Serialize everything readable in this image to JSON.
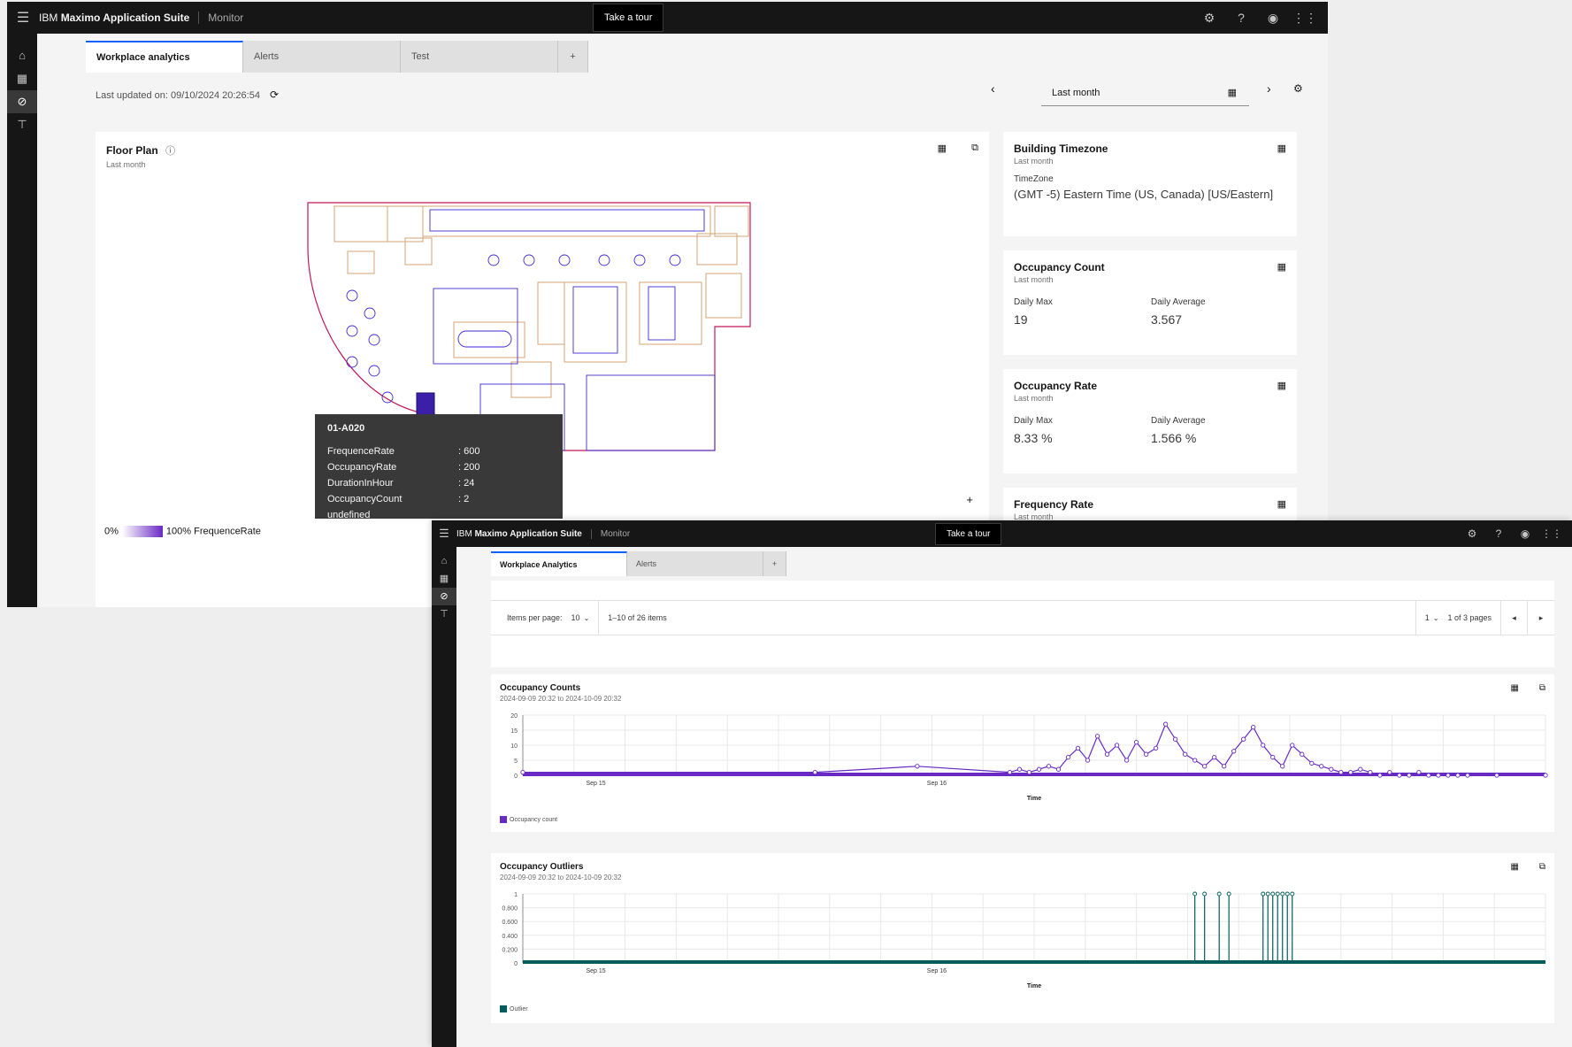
{
  "app": {
    "brand_prefix": "IBM",
    "brand_name": "Maximo Application Suite",
    "product": "Monitor",
    "tour": "Take a tour"
  },
  "icons": {
    "hamburger": "☰",
    "settings": "⚙",
    "help": "?",
    "user": "◉",
    "apps": "⋮⋮",
    "home": "⌂",
    "grid": "▦",
    "compass": "⊘",
    "network": "⊤",
    "calendar": "▦",
    "expand": "⧉",
    "info": "ⓘ",
    "refresh": "⟳",
    "prev": "‹",
    "next": "›",
    "plus": "+"
  },
  "win1": {
    "tabs": [
      "Workplace analytics",
      "Alerts",
      "Test",
      "+"
    ],
    "last_updated": "Last updated on:  09/10/2024 20:26:54",
    "date_range": "Last month",
    "floorplan": {
      "title": "Floor Plan",
      "subtitle": "Last month",
      "legend_min": "0%",
      "legend_max": "100% FrequenceRate",
      "zoom": "+"
    },
    "tooltip": {
      "title": "01-A020",
      "rows": [
        {
          "k": "FrequenceRate",
          "v": ": 600"
        },
        {
          "k": "OccupancyRate",
          "v": ": 200"
        },
        {
          "k": "DurationInHour",
          "v": ": 24"
        },
        {
          "k": "OccupancyCount",
          "v": ": 2"
        }
      ],
      "footer": "undefined"
    },
    "timezone": {
      "title": "Building Timezone",
      "subtitle": "Last month",
      "label": "TimeZone",
      "value": "(GMT -5) Eastern Time (US, Canada) [US/Eastern]"
    },
    "occ_count": {
      "title": "Occupancy Count",
      "subtitle": "Last month",
      "max_label": "Daily Max",
      "max_value": "19",
      "avg_label": "Daily Average",
      "avg_value": "3.567"
    },
    "occ_rate": {
      "title": "Occupancy Rate",
      "subtitle": "Last month",
      "max_label": "Daily Max",
      "max_value": "8.33 %",
      "avg_label": "Daily Average",
      "avg_value": "1.566 %"
    },
    "freq_rate": {
      "title": "Frequency Rate",
      "subtitle": "Last month"
    }
  },
  "win2": {
    "tabs": [
      "Workplace Analytics",
      "Alerts",
      "+"
    ],
    "pager": {
      "items_label": "Items per page:",
      "items_value": "10",
      "range": "1–10 of 26 items",
      "page_value": "1",
      "pages": "1 of 3 pages"
    },
    "chart1": {
      "title": "Occupancy Counts",
      "subtitle": "2024-09-09 20:32 to 2024-10-09 20:32",
      "ticks": [
        "20",
        "15",
        "10",
        "5",
        "0"
      ],
      "xticks": [
        "Sep 15",
        "Sep 16"
      ],
      "xlabel": "Time",
      "legend": "Occupancy count"
    },
    "chart2": {
      "title": "Occupancy Outliers",
      "subtitle": "2024-09-09 20:32 to 2024-10-09 20:32",
      "ticks": [
        "1",
        "0.800",
        "0.600",
        "0.400",
        "0.200",
        "0"
      ],
      "xticks": [
        "Sep 15",
        "Sep 16"
      ],
      "xlabel": "Time",
      "legend": "Outlier"
    }
  },
  "colors": {
    "accent": "#0f62fe",
    "series_purple": "#6929c4",
    "series_teal": "#005d5d"
  },
  "chart_data": [
    {
      "type": "line",
      "title": "Occupancy Counts",
      "subtitle": "2024-09-09 20:32 to 2024-10-09 20:32",
      "xlabel": "Time",
      "ylabel": "",
      "ylim": [
        0,
        20
      ],
      "x_ticks": [
        "Sep 15",
        "Sep 16"
      ],
      "series": [
        {
          "name": "Occupancy count",
          "x": [
            0.0,
            0.6,
            0.81,
            1.0,
            1.02,
            1.04,
            1.06,
            1.08,
            1.1,
            1.12,
            1.14,
            1.16,
            1.18,
            1.2,
            1.22,
            1.24,
            1.26,
            1.28,
            1.3,
            1.32,
            1.34,
            1.36,
            1.38,
            1.4,
            1.42,
            1.44,
            1.46,
            1.48,
            1.5,
            1.52,
            1.54,
            1.56,
            1.58,
            1.6,
            1.62,
            1.64,
            1.66,
            1.68,
            1.7,
            1.72,
            1.74,
            1.76,
            1.78,
            1.8,
            1.82,
            1.84,
            1.86,
            1.88,
            1.9,
            1.92,
            1.94,
            2.0,
            2.1
          ],
          "values": [
            1,
            1,
            3,
            1,
            2,
            1,
            2,
            3,
            2,
            6,
            9,
            5,
            13,
            7,
            10,
            5,
            11,
            7,
            9,
            17,
            12,
            7,
            5,
            3,
            6,
            3,
            8,
            12,
            16,
            10,
            6,
            3,
            10,
            7,
            4,
            3,
            2,
            1,
            1,
            2,
            1,
            0,
            1,
            0,
            0,
            1,
            0,
            0,
            0,
            0,
            0,
            0,
            0
          ]
        }
      ]
    },
    {
      "type": "line",
      "title": "Occupancy Outliers",
      "subtitle": "2024-09-09 20:32 to 2024-10-09 20:32",
      "xlabel": "Time",
      "ylabel": "",
      "ylim": [
        0,
        1
      ],
      "x_ticks": [
        "Sep 15",
        "Sep 16"
      ],
      "series": [
        {
          "name": "Outlier",
          "x": [
            1.38,
            1.4,
            1.43,
            1.45,
            1.52,
            1.53,
            1.54,
            1.55,
            1.56,
            1.57,
            1.58
          ],
          "values": [
            1,
            1,
            1,
            1,
            1,
            1,
            1,
            1,
            1,
            1,
            1
          ]
        }
      ]
    }
  ]
}
